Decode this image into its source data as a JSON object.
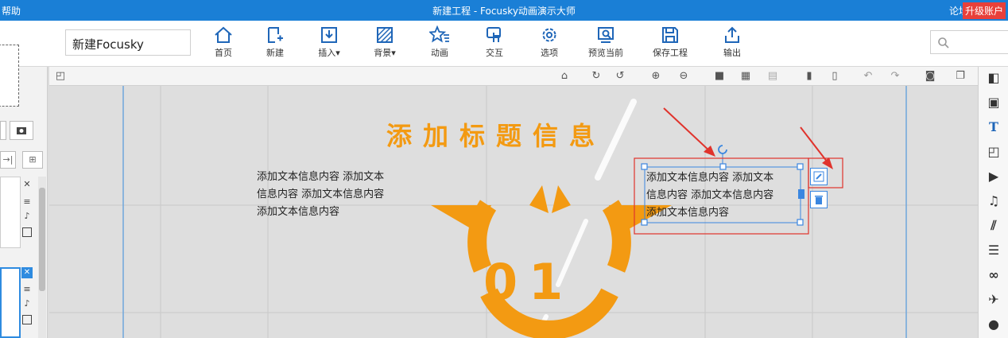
{
  "titlebar": {
    "left_text": "帮助",
    "title": "新建工程 - Focusky动画演示大师",
    "forum": "论坛",
    "upgrade": "升级账户"
  },
  "toolbar": {
    "project_name": "新建Focusky",
    "buttons": [
      {
        "label": "首页",
        "icon": "home-icon"
      },
      {
        "label": "新建",
        "icon": "new-icon"
      },
      {
        "label": "插入▾",
        "icon": "insert-icon"
      },
      {
        "label": "背景▾",
        "icon": "background-icon"
      },
      {
        "label": "动画",
        "icon": "animation-icon"
      },
      {
        "label": "交互",
        "icon": "interaction-icon"
      },
      {
        "label": "选项",
        "icon": "settings-icon"
      },
      {
        "label": "预览当前",
        "icon": "preview-icon"
      },
      {
        "label": "保存工程",
        "icon": "save-icon"
      },
      {
        "label": "输出",
        "icon": "export-icon"
      }
    ]
  },
  "canvas": {
    "heading": "添加标题信息",
    "left_text": [
      "添加文本信息内容 添加文本",
      "信息内容 添加文本信息内容",
      "添加文本信息内容"
    ],
    "right_text": [
      "添加文本信息内容 添加文本",
      "信息内容 添加文本信息内容",
      "添加文本信息内容"
    ],
    "number": "01"
  },
  "colors": {
    "accent": "#f39a12",
    "titlebar": "#1a7fd6",
    "annotation_red": "#e0332c",
    "selection_blue": "#3a86e0"
  },
  "rightbar_icons": [
    "shape-icon",
    "image-icon",
    "text-icon",
    "frame-icon",
    "video-icon",
    "music-icon",
    "chart-icon",
    "people-icon",
    "link-icon",
    "plane-icon",
    "flash-icon"
  ]
}
